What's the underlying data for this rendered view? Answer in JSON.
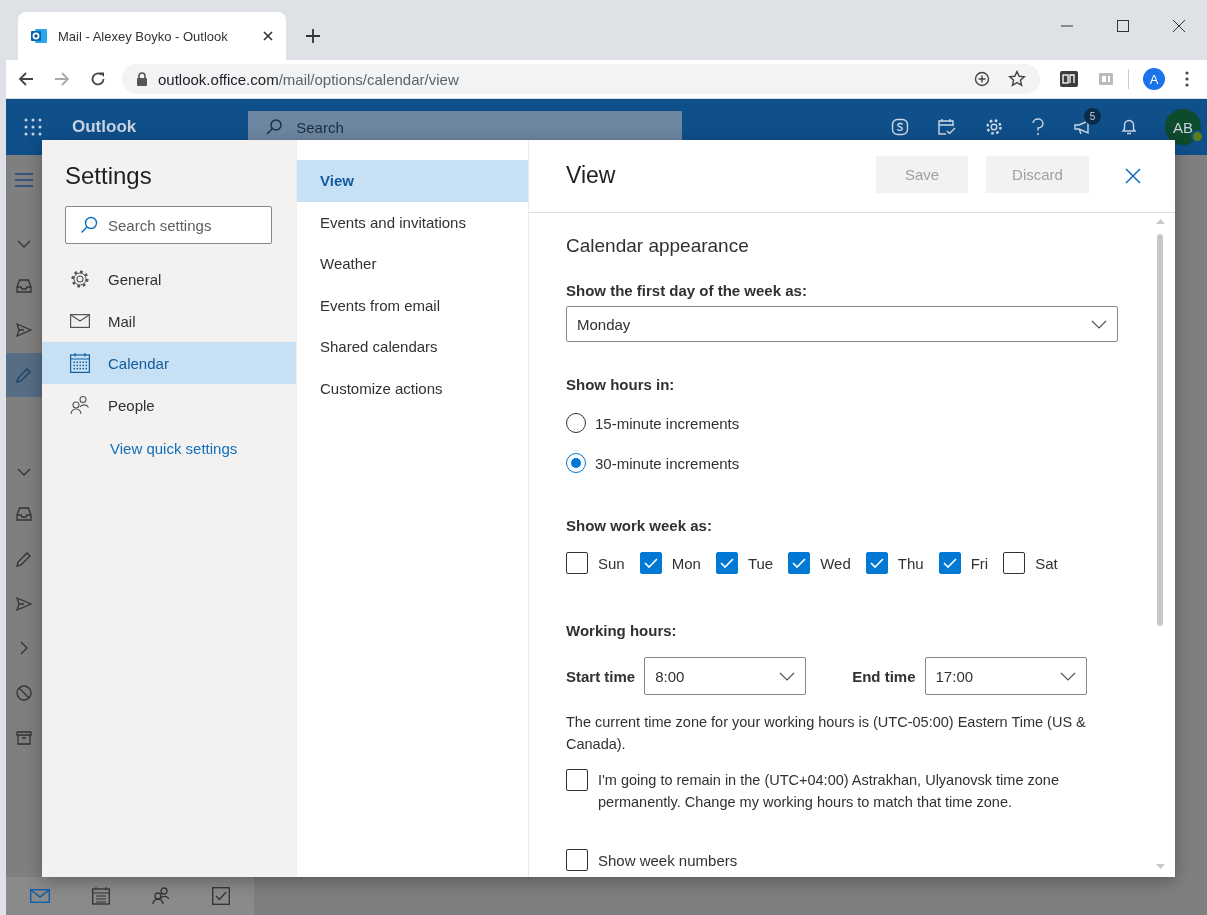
{
  "browser": {
    "tab_title": "Mail - Alexey Boyko - Outlook",
    "url_host": "outlook.office.com",
    "url_path": "/mail/options/calendar/view",
    "profile": "A"
  },
  "app": {
    "name": "Outlook",
    "search_placeholder": "Search",
    "notification_count": "5",
    "avatar": "AB"
  },
  "bottom_nav": [
    {
      "kind": "mail",
      "selected": true
    },
    {
      "kind": "calendar",
      "selected": false
    },
    {
      "kind": "people",
      "selected": false
    },
    {
      "kind": "tasks",
      "selected": false
    }
  ],
  "settings": {
    "title": "Settings",
    "search_placeholder": "Search settings",
    "categories": [
      {
        "kind": "gear",
        "label": "General",
        "selected": false
      },
      {
        "kind": "mail",
        "label": "Mail",
        "selected": false
      },
      {
        "kind": "calendar",
        "label": "Calendar",
        "selected": true
      },
      {
        "kind": "people",
        "label": "People",
        "selected": false
      }
    ],
    "quick_settings_link": "View quick settings",
    "subsections": [
      {
        "label": "View",
        "selected": true
      },
      {
        "label": "Events and invitations",
        "selected": false
      },
      {
        "label": "Weather",
        "selected": false
      },
      {
        "label": "Events from email",
        "selected": false
      },
      {
        "label": "Shared calendars",
        "selected": false
      },
      {
        "label": "Customize actions",
        "selected": false
      }
    ]
  },
  "view": {
    "title": "View",
    "save": {
      "label": "Save",
      "disabled": true
    },
    "discard": {
      "label": "Discard",
      "disabled": true
    },
    "section": "Calendar appearance",
    "first_day": {
      "label": "Show the first day of the week as:",
      "value": "Monday"
    },
    "hours": {
      "label": "Show hours in:",
      "options": [
        {
          "label": "15-minute increments",
          "selected": false
        },
        {
          "label": "30-minute increments",
          "selected": true
        }
      ]
    },
    "work_week": {
      "label": "Show work week as:",
      "days": [
        {
          "label": "Sun",
          "checked": false
        },
        {
          "label": "Mon",
          "checked": true
        },
        {
          "label": "Tue",
          "checked": true
        },
        {
          "label": "Wed",
          "checked": true
        },
        {
          "label": "Thu",
          "checked": true
        },
        {
          "label": "Fri",
          "checked": true
        },
        {
          "label": "Sat",
          "checked": false
        }
      ]
    },
    "working_hours": {
      "label": "Working hours:",
      "start_label": "Start time",
      "start_value": "8:00",
      "end_label": "End time",
      "end_value": "17:00",
      "timezone_note": "The current time zone for your working hours is (UTC-05:00) Eastern Time (US & Canada).",
      "remain": {
        "label": "I'm going to remain in the (UTC+04:00) Astrakhan, Ulyanovsk time zone permanently. Change my working hours to match that time zone.",
        "checked": false
      }
    },
    "week_numbers": {
      "label": "Show week numbers",
      "checked": false
    }
  }
}
